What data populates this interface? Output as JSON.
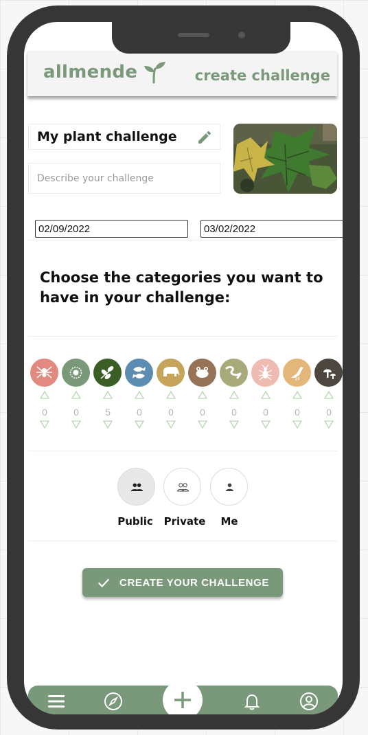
{
  "app": {
    "brand": "allmende",
    "screen_title": "create challenge"
  },
  "form": {
    "name_value": "My plant challenge",
    "description_placeholder": "Describe your challenge",
    "start_date": "02/09/2022",
    "end_date": "03/02/2022",
    "prompt": "Choose the categories you want to have in your challenge:"
  },
  "categories": [
    {
      "icon": "spider-icon",
      "color": "#e38a80",
      "count": "0"
    },
    {
      "icon": "coral-icon",
      "color": "#7a987a",
      "count": "0"
    },
    {
      "icon": "plant-icon",
      "color": "#3a5e26",
      "count": "5"
    },
    {
      "icon": "fish-icon",
      "color": "#5c8cb0",
      "count": "0"
    },
    {
      "icon": "mammal-icon",
      "color": "#c6a45c",
      "count": "0"
    },
    {
      "icon": "amphibian-icon",
      "color": "#967256",
      "count": "0"
    },
    {
      "icon": "reptile-icon",
      "color": "#a9aa7a",
      "count": "0"
    },
    {
      "icon": "insect-icon",
      "color": "#eebbb0",
      "count": "0"
    },
    {
      "icon": "bird-icon",
      "color": "#e3b67a",
      "count": "0"
    },
    {
      "icon": "fungi-icon",
      "color": "#4c463e",
      "count": "0"
    }
  ],
  "visibility": [
    {
      "label": "Public",
      "icon": "group-icon",
      "selected": true
    },
    {
      "label": "Private",
      "icon": "group-outline-icon",
      "selected": false
    },
    {
      "label": "Me",
      "icon": "person-icon",
      "selected": false
    }
  ],
  "create_button": {
    "label": "CREATE YOUR CHALLENGE"
  },
  "nav": [
    "menu-icon",
    "compass-icon",
    "plus-icon",
    "bell-icon",
    "account-icon"
  ],
  "colors": {
    "accent": "#7a987a",
    "phone_frame": "#363636",
    "arrow": "#b9d6b4"
  }
}
